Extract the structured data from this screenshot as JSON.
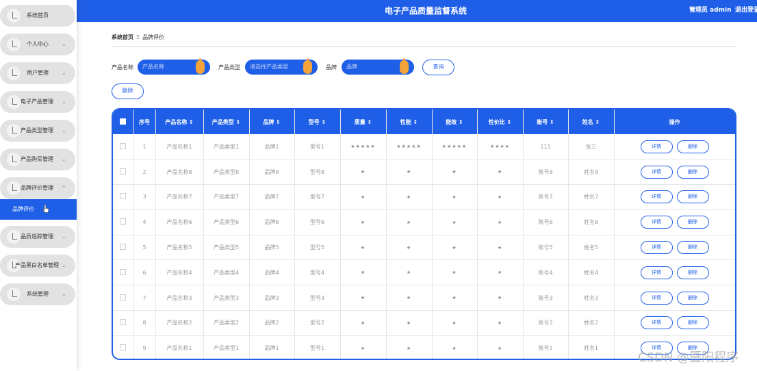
{
  "topbar": {
    "title": "电子产品质量监督系统",
    "user": "管理员 admin",
    "logout": "退出登录"
  },
  "sidebar": {
    "items": [
      {
        "label": "系统首页",
        "arrow": ""
      },
      {
        "label": "个人中心",
        "arrow": "⌄"
      },
      {
        "label": "用户管理",
        "arrow": "⌄"
      },
      {
        "label": "电子产品管理",
        "arrow": "⌄"
      },
      {
        "label": "产品类型管理",
        "arrow": "⌄"
      },
      {
        "label": "产品购买管理",
        "arrow": "⌄"
      },
      {
        "label": "品牌评价管理",
        "arrow": "^"
      },
      {
        "label": "品质追踪管理",
        "arrow": "⌄"
      },
      {
        "label": "产品黑白名单管理",
        "arrow": "⌄"
      },
      {
        "label": "系统管理",
        "arrow": "⌄"
      }
    ],
    "active_sub": "品牌评价"
  },
  "breadcrumb": {
    "home": "系统首页",
    "sep": "Ξ",
    "current": "品牌评价"
  },
  "search": {
    "name_label": "产品名称",
    "name_placeholder": "产品名称",
    "type_label": "产品类型",
    "type_placeholder": "请选择产品类型",
    "brand_label": "品牌",
    "brand_placeholder": "品牌",
    "query_button": "查询"
  },
  "delete_button": "删除",
  "table": {
    "headers": [
      "序号",
      "产品名称 ⇕",
      "产品类型 ⇕",
      "品牌 ⇕",
      "型号 ⇕",
      "质量 ⇕",
      "性能 ⇕",
      "能效 ⇕",
      "性价比 ⇕",
      "账号 ⇕",
      "姓名 ⇕",
      "操作"
    ],
    "detail_label": "详情",
    "delete_label": "删除",
    "rows": [
      {
        "idx": "1",
        "name": "产品名称1",
        "type": "产品类型1",
        "brand": "品牌1",
        "model": "型号1",
        "quality": "★★★★★",
        "performance": "★★★★★",
        "efficiency": "★★★★★",
        "value": "★★★★",
        "account": "111",
        "person": "张三"
      },
      {
        "idx": "2",
        "name": "产品名称8",
        "type": "产品类型8",
        "brand": "品牌8",
        "model": "型号8",
        "quality": "★",
        "performance": "★",
        "efficiency": "★",
        "value": "★",
        "account": "账号8",
        "person": "姓名8"
      },
      {
        "idx": "3",
        "name": "产品名称7",
        "type": "产品类型7",
        "brand": "品牌7",
        "model": "型号7",
        "quality": "★",
        "performance": "★",
        "efficiency": "★",
        "value": "★",
        "account": "账号7",
        "person": "姓名7"
      },
      {
        "idx": "4",
        "name": "产品名称6",
        "type": "产品类型6",
        "brand": "品牌6",
        "model": "型号6",
        "quality": "★",
        "performance": "★",
        "efficiency": "★",
        "value": "★",
        "account": "账号6",
        "person": "姓名6"
      },
      {
        "idx": "5",
        "name": "产品名称5",
        "type": "产品类型5",
        "brand": "品牌5",
        "model": "型号5",
        "quality": "★",
        "performance": "★",
        "efficiency": "★",
        "value": "★",
        "account": "账号5",
        "person": "姓名5"
      },
      {
        "idx": "6",
        "name": "产品名称4",
        "type": "产品类型4",
        "brand": "品牌4",
        "model": "型号4",
        "quality": "★",
        "performance": "★",
        "efficiency": "★",
        "value": "★",
        "account": "账号4",
        "person": "姓名4"
      },
      {
        "idx": "7",
        "name": "产品名称3",
        "type": "产品类型3",
        "brand": "品牌3",
        "model": "型号3",
        "quality": "★",
        "performance": "★",
        "efficiency": "★",
        "value": "★",
        "account": "账号3",
        "person": "姓名3"
      },
      {
        "idx": "8",
        "name": "产品名称2",
        "type": "产品类型2",
        "brand": "品牌2",
        "model": "型号2",
        "quality": "★",
        "performance": "★",
        "efficiency": "★",
        "value": "★",
        "account": "账号2",
        "person": "姓名2"
      },
      {
        "idx": "9",
        "name": "产品名称1",
        "type": "产品类型1",
        "brand": "品牌1",
        "model": "型号1",
        "quality": "★",
        "performance": "★",
        "efficiency": "★",
        "value": "★",
        "account": "账号1",
        "person": "姓名1"
      }
    ]
  },
  "watermark": "CSDN @暨阳程序",
  "colors": {
    "primary": "#1f5fe8",
    "knob": "#f4a23a"
  }
}
